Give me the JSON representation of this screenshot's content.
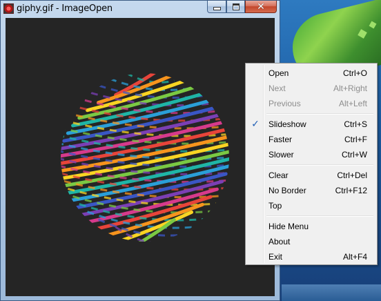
{
  "window": {
    "title": "giphy.gif - ImageOpen",
    "buttons": {
      "minimize": "minimize",
      "maximize": "maximize",
      "close": "✕"
    }
  },
  "image": {
    "description_icon": "striped-sphere-gif"
  },
  "menu": {
    "groups": [
      [
        {
          "label": "Open",
          "shortcut": "Ctrl+O",
          "enabled": true,
          "checked": false
        },
        {
          "label": "Next",
          "shortcut": "Alt+Right",
          "enabled": false,
          "checked": false
        },
        {
          "label": "Previous",
          "shortcut": "Alt+Left",
          "enabled": false,
          "checked": false
        }
      ],
      [
        {
          "label": "Slideshow",
          "shortcut": "Ctrl+S",
          "enabled": true,
          "checked": true
        },
        {
          "label": "Faster",
          "shortcut": "Ctrl+F",
          "enabled": true,
          "checked": false
        },
        {
          "label": "Slower",
          "shortcut": "Ctrl+W",
          "enabled": true,
          "checked": false
        }
      ],
      [
        {
          "label": "Clear",
          "shortcut": "Ctrl+Del",
          "enabled": true,
          "checked": false
        },
        {
          "label": "No Border",
          "shortcut": "Ctrl+F12",
          "enabled": true,
          "checked": false
        },
        {
          "label": "Top",
          "shortcut": "",
          "enabled": true,
          "checked": false
        }
      ],
      [
        {
          "label": "Hide Menu",
          "shortcut": "",
          "enabled": true,
          "checked": false
        },
        {
          "label": "About",
          "shortcut": "",
          "enabled": true,
          "checked": false
        },
        {
          "label": "Exit",
          "shortcut": "Alt+F4",
          "enabled": true,
          "checked": false
        }
      ]
    ],
    "check_glyph": "✓"
  },
  "colors": {
    "canvas_bg": "#252525",
    "stripes": [
      "#e8443a",
      "#f7941d",
      "#f9d423",
      "#7ac943",
      "#1fb5a6",
      "#2a9fd8",
      "#3a56c5",
      "#7b3fb5",
      "#d63a8c"
    ]
  }
}
